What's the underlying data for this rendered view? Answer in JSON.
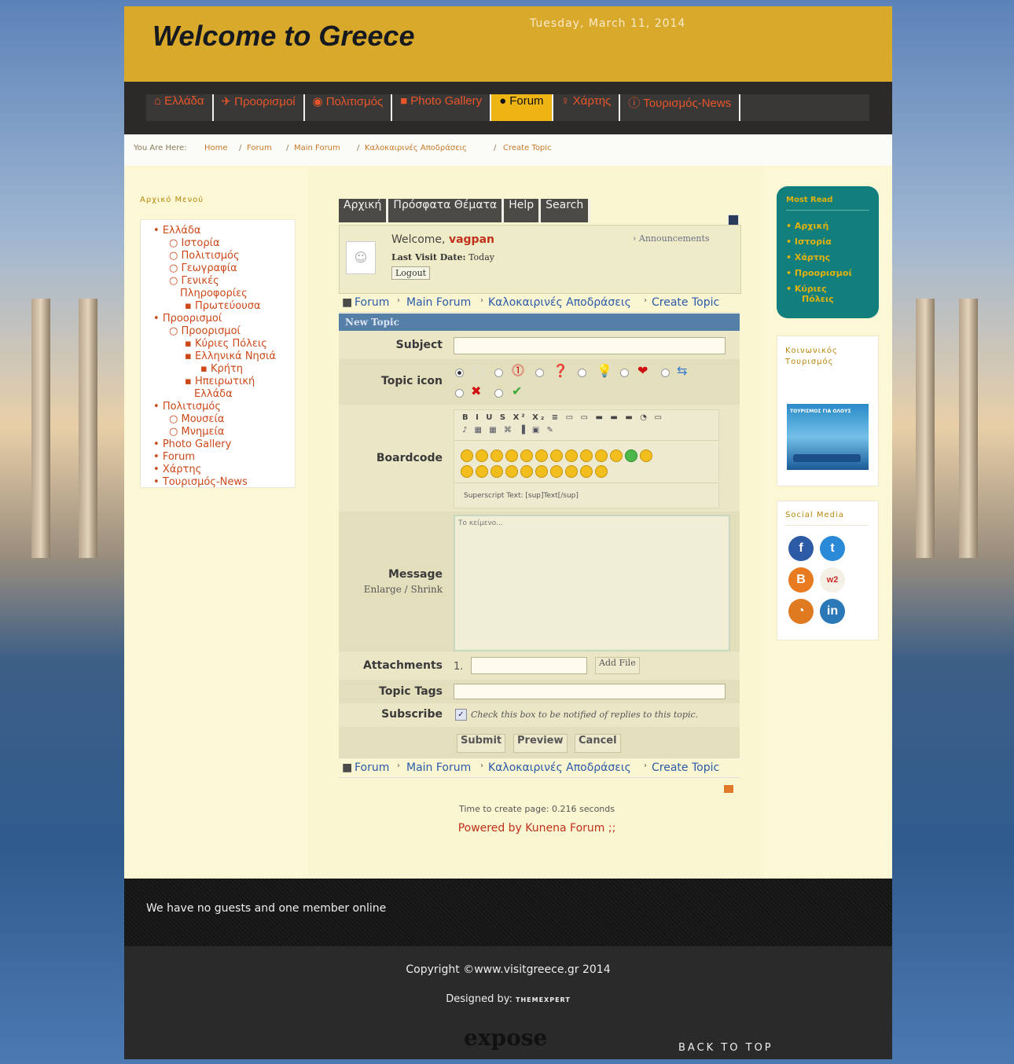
{
  "header": {
    "site_title": "Welcome to Greece",
    "date": "Tuesday, March 11, 2014"
  },
  "nav": {
    "items": [
      {
        "icon": "home-icon",
        "label": "Ελλάδα"
      },
      {
        "icon": "plane-icon",
        "label": "Προορισμοί"
      },
      {
        "icon": "eye-icon",
        "label": "Πολιτισμός"
      },
      {
        "icon": "camera-icon",
        "label": "Photo Gallery"
      },
      {
        "icon": "comment-icon",
        "label": "Forum",
        "active": true
      },
      {
        "icon": "map-marker-icon",
        "label": "Χάρτης"
      },
      {
        "icon": "info-icon",
        "label": "Τουρισμός-News"
      }
    ]
  },
  "breadcrumb": {
    "prefix": "You Are Here:",
    "items": [
      "Home",
      "Forum",
      "Main Forum",
      "Καλοκαιρινές Αποδράσεις",
      "Create Topic"
    ]
  },
  "left_menu": {
    "title": "Αρχικό Μενού",
    "items": [
      "Ελλάδα",
      "Ιστορία",
      "Πολιτισμός",
      "Γεωγραφία",
      "Γενικές",
      "Πληροφορίες",
      "Πρωτεύουσα",
      "Προορισμοί",
      "Προορισμοί",
      "Κύριες Πόλεις",
      "Ελληνικά Νησιά",
      "Κρήτη",
      "Ηπειρωτική",
      "Ελλάδα",
      "Πολιτισμός",
      "Μουσεία",
      "Μνημεία",
      "Photo Gallery",
      "Forum",
      "Χάρτης",
      "Τουρισμός-News"
    ]
  },
  "forum": {
    "tabs": [
      "Αρχική",
      "Πρόσφατα Θέματα",
      "Help",
      "Search"
    ],
    "welcome_text": "Welcome,",
    "username": "vagpan",
    "last_visit_label": "Last Visit Date:",
    "last_visit_value": "Today",
    "logout": "Logout",
    "announcements": "Announcements",
    "pathway": [
      "Forum",
      "Main Forum",
      "Καλοκαιρινές Αποδράσεις",
      "Create Topic"
    ],
    "form_header": "New Topic",
    "subject_label": "Subject",
    "topic_icon_label": "Topic icon",
    "boardcode_label": "Boardcode",
    "boardcode_hint": "Superscript Text: [sup]Text[/sup]",
    "message_label": "Message",
    "enlarge": "Enlarge",
    "shrink": "Shrink",
    "message_placeholder": "Το κείμενο...",
    "attachments_label": "Attachments",
    "attachment_index": "1.",
    "add_file": "Add File",
    "tags_label": "Topic Tags",
    "subscribe_label": "Subscribe",
    "subscribe_text": "Check this box to be notified of replies to this topic.",
    "subscribe_checked": true,
    "submit": "Submit",
    "preview": "Preview",
    "cancel": "Cancel",
    "time_text": "Time to create page: 0.216 seconds",
    "powered_by": "Powered by Kunena Forum ;;"
  },
  "right": {
    "mostread_title": "Most Read",
    "mostread_items": [
      "Αρχική",
      "Ιστορία",
      "Χάρτης",
      "Προορισμοί",
      "Κύριες",
      "Πόλεις"
    ],
    "tourism_title": "Κοινωνικός Τουρισμός",
    "banner_text": "ΤΟΥΡΙΣΜΟΣ ΓΙΑ ΟΛΟΥΣ",
    "social_title": "Social Media",
    "social_icons": [
      "facebook-icon",
      "twitter-icon",
      "blogger-icon",
      "web2-icon",
      "rss-icon",
      "linkedin-icon"
    ]
  },
  "footer": {
    "online": "We have no guests and one member online",
    "copyright": "Copyright ©www.visitgreece.gr 2014",
    "designed_by": "Designed by:",
    "designer": "THEMEXPERT",
    "logo_text": "expose",
    "back_to_top": "BACK TO TOP"
  },
  "colors": {
    "header_gold": "#d8a92b",
    "nav_dark": "#2b2a28",
    "nav_text": "#e8552a",
    "nav_active": "#eeb414",
    "page_cream": "#fcf8d6",
    "mostread_teal": "#137f7d",
    "link_blue": "#2a5aa8"
  }
}
